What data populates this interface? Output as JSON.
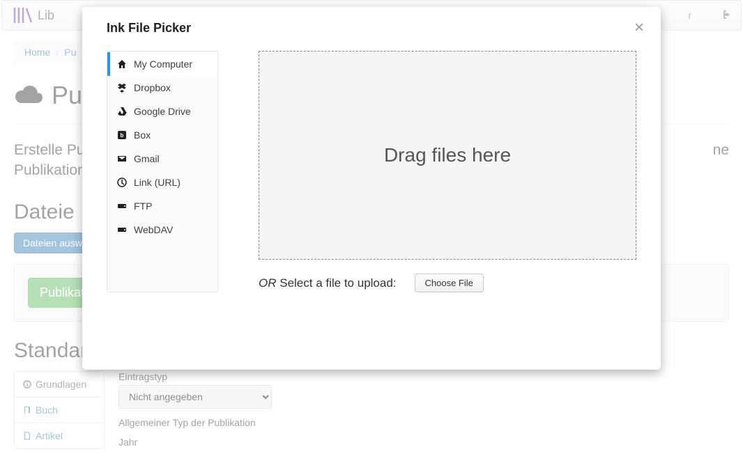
{
  "navbar": {
    "brand": "Lib",
    "right_item": "r"
  },
  "breadcrumb": {
    "home": "Home",
    "second": "Pu"
  },
  "page": {
    "title": "Pu",
    "intro_a": "Erstelle Pu",
    "intro_b": "Publikation",
    "intro_c": "ne",
    "files_h": "Dateie",
    "select_btn": "Dateien ausw",
    "publish_btn": "Publikatio",
    "defaults_h": "Standard",
    "defaults_sub": ""
  },
  "sidenav": {
    "basics": "Grundlagen",
    "book": "Buch",
    "article": "Artikel"
  },
  "form": {
    "entry_label": "Eintragstyp",
    "entry_value": "Nicht angegeben",
    "pubtype_label": "Allgemeiner Typ der Publikation",
    "year_label": "Jahr"
  },
  "modal": {
    "title": "Ink File Picker",
    "close": "×",
    "sources": {
      "my_computer": "My Computer",
      "dropbox": "Dropbox",
      "gdrive": "Google Drive",
      "box": "Box",
      "gmail": "Gmail",
      "link": "Link (URL)",
      "ftp": "FTP",
      "webdav": "WebDAV"
    },
    "drop_text": "Drag files here",
    "or": "OR",
    "or_text": "Select a file to upload:",
    "choose": "Choose File"
  }
}
